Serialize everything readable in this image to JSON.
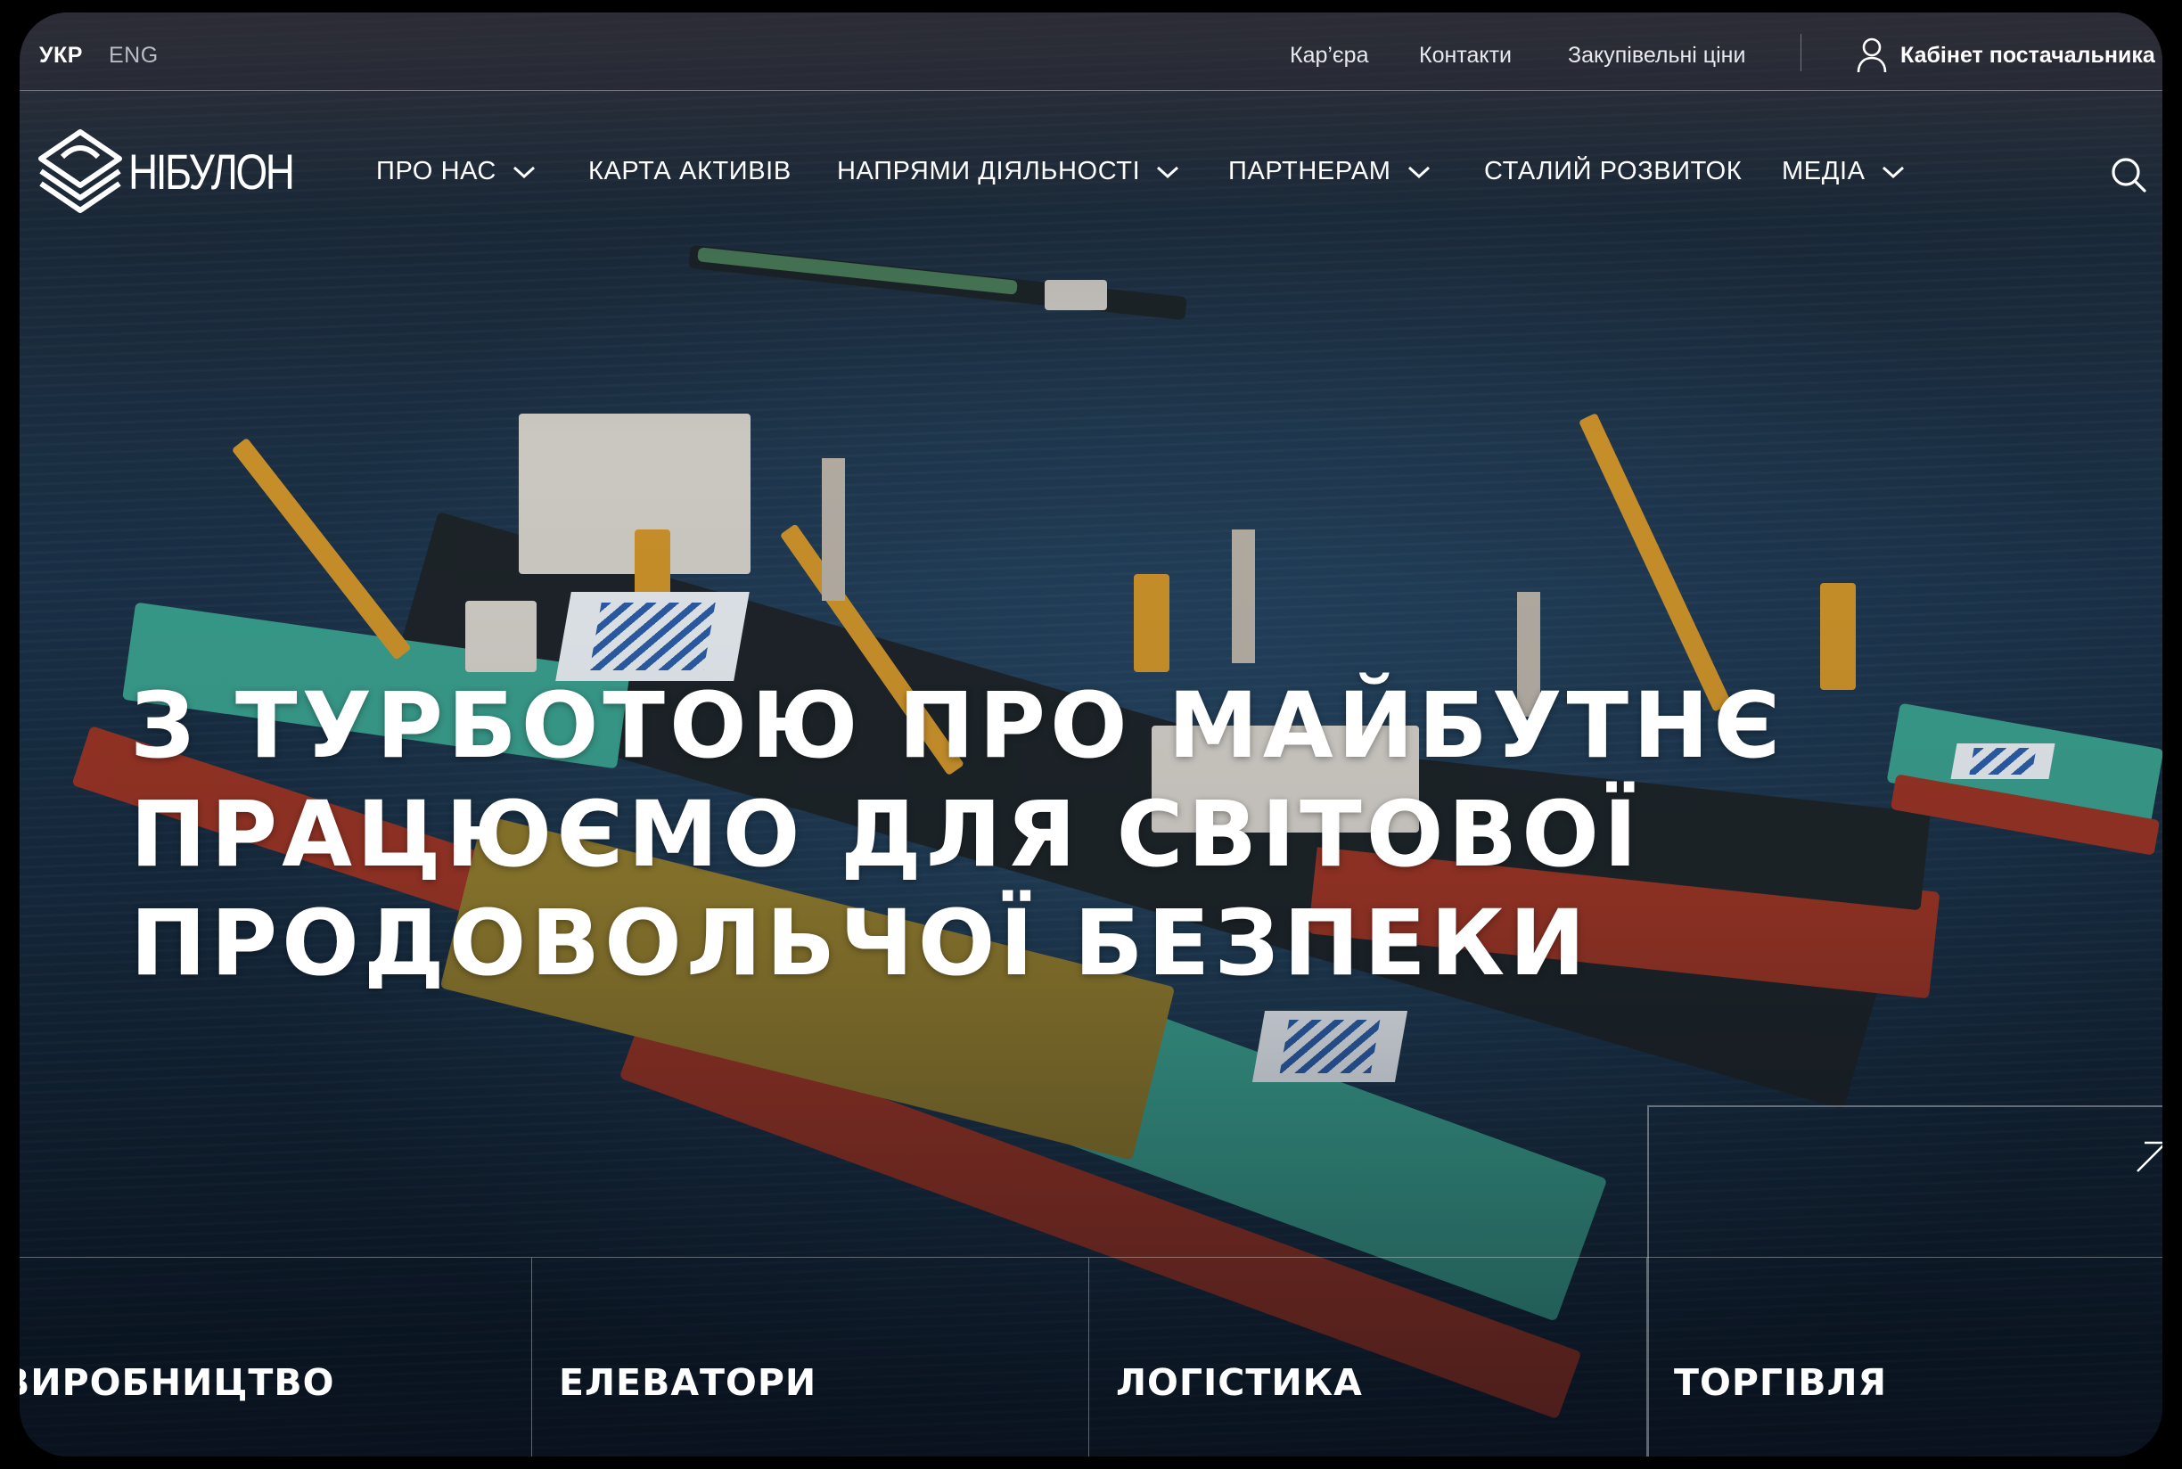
{
  "topbar": {
    "languages": [
      {
        "label": "УКР",
        "active": true
      },
      {
        "label": "ENG",
        "active": false
      }
    ],
    "links": [
      "Кар’єра",
      "Контакти",
      "Закупівельні ціни"
    ],
    "supplier_cabinet": "Кабінет постачальника",
    "user_icon": "user-icon"
  },
  "nav": {
    "logo_text": "НІБУЛОН",
    "items": [
      {
        "label": "ПРО НАС",
        "dropdown": true
      },
      {
        "label": "КАРТА АКТИВІВ",
        "dropdown": false
      },
      {
        "label": "НАПРЯМИ ДІЯЛЬНОСТІ",
        "dropdown": true
      },
      {
        "label": "ПАРТНЕРАМ",
        "dropdown": true
      },
      {
        "label": "СТАЛИЙ РОЗВИТОК",
        "dropdown": false
      },
      {
        "label": "МЕДІА",
        "dropdown": true
      }
    ],
    "search_icon": "search-icon"
  },
  "hero": {
    "headline_lines": [
      "З турботою про майбутнє",
      "працюємо для світової",
      "продовольчої безпеки"
    ],
    "arrow_icon": "arrow-up-right-icon"
  },
  "categories": [
    "ВИРОБНИЦТВО",
    "ЕЛЕВАТОРИ",
    "ЛОГІСТИКА",
    "ТОРГІВЛЯ"
  ],
  "colors": {
    "text": "#ffffff",
    "muted_text": "#b9bcc4",
    "water": "#1a3148",
    "accent_crane": "#d0952a"
  }
}
